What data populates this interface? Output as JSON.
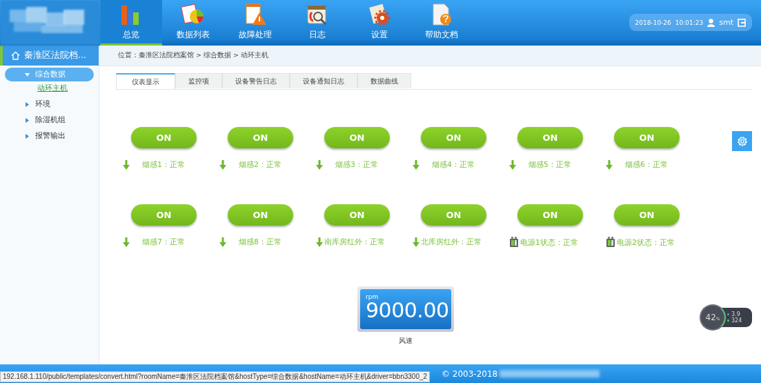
{
  "header": {
    "nav": [
      {
        "label": "总览",
        "kind": "books",
        "selected": true
      },
      {
        "label": "数据列表",
        "kind": "chart",
        "selected": false
      },
      {
        "label": "故障处理",
        "kind": "warning",
        "selected": false
      },
      {
        "label": "日志",
        "kind": "calendar",
        "selected": false
      },
      {
        "label": "设置",
        "kind": "gear",
        "selected": false
      },
      {
        "label": "帮助文档",
        "kind": "help",
        "selected": false
      }
    ],
    "date": "2018-10-26",
    "time": "10:01:23",
    "user": "smt"
  },
  "sidebar": {
    "title": "秦淮区法院档...",
    "items": [
      {
        "label": "综合数据",
        "expanded": true,
        "selected": true,
        "children": [
          {
            "label": "动环主机",
            "selected": true
          }
        ]
      },
      {
        "label": "环境",
        "expanded": false,
        "selected": false
      },
      {
        "label": "除湿机组",
        "expanded": false,
        "selected": false
      },
      {
        "label": "报警输出",
        "expanded": false,
        "selected": false
      }
    ]
  },
  "breadcrumb": "位置：秦淮区法院档案馆 > 综合数据 > 动环主机",
  "tabs": [
    {
      "label": "仪表显示",
      "selected": true
    },
    {
      "label": "监控项",
      "selected": false
    },
    {
      "label": "设备警告日志",
      "selected": false
    },
    {
      "label": "设备通知日志",
      "selected": false
    },
    {
      "label": "数据曲线",
      "selected": false
    }
  ],
  "sensors": [
    {
      "state": "ON",
      "kind": "arrow",
      "label": "烟感1：正常"
    },
    {
      "state": "ON",
      "kind": "arrow",
      "label": "烟感2：正常"
    },
    {
      "state": "ON",
      "kind": "arrow",
      "label": "烟感3：正常"
    },
    {
      "state": "ON",
      "kind": "arrow",
      "label": "烟感4：正常"
    },
    {
      "state": "ON",
      "kind": "arrow",
      "label": "烟感5：正常"
    },
    {
      "state": "ON",
      "kind": "arrow",
      "label": "烟感6：正常"
    },
    {
      "state": "ON",
      "kind": "arrow",
      "label": "烟感7：正常"
    },
    {
      "state": "ON",
      "kind": "arrow",
      "label": "烟感8：正常"
    },
    {
      "state": "ON",
      "kind": "arrow-tight",
      "label": "南库房红外：正常"
    },
    {
      "state": "ON",
      "kind": "arrow-tight",
      "label": "北库房红外：正常"
    },
    {
      "state": "ON",
      "kind": "power",
      "label": "电源1状态：正常"
    },
    {
      "state": "ON",
      "kind": "power",
      "label": "电源2状态：正常"
    }
  ],
  "gauge": {
    "unit": "rpm",
    "value": "9000.00",
    "label": "风速"
  },
  "network_widget": {
    "percent": "42",
    "unit": "%",
    "upload": "3.9",
    "download": "324"
  },
  "footer": {
    "copyright": "© 2003-2018"
  },
  "status_url": "192.168.1.110/public/templates/convert.html?roomName=秦淮区法院档案馆&hostType=综合数据&hostName=动环主机&driver=bbn3300_2"
}
